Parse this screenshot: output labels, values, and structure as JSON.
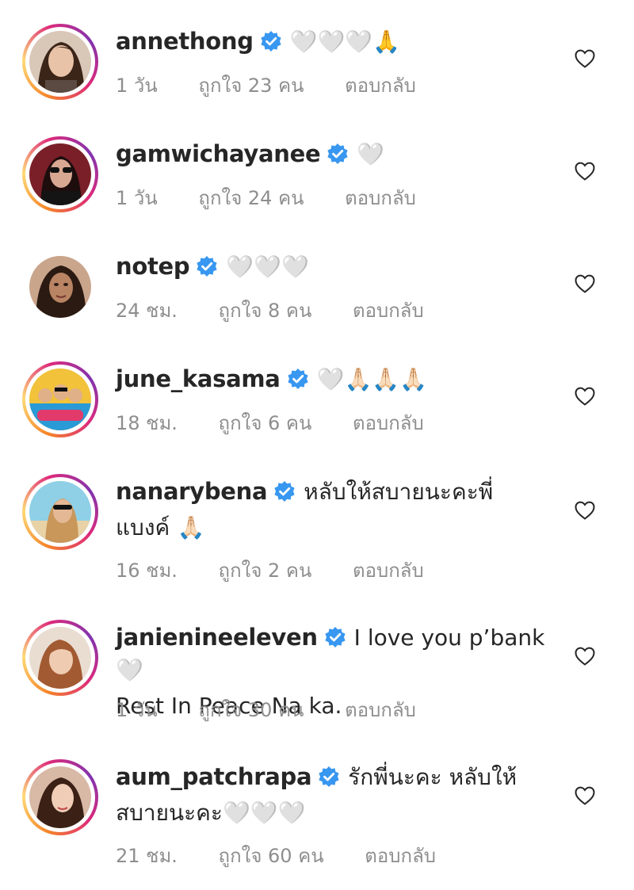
{
  "comments": [
    {
      "username": "annethong",
      "text": "",
      "emoji": "🤍🤍🤍🙏",
      "time": "1 วัน",
      "likes": "ถูกใจ 23 คน",
      "reply": "ตอบกลับ"
    },
    {
      "username": "gamwichayanee",
      "text": "",
      "emoji": "🤍",
      "time": "1 วัน",
      "likes": "ถูกใจ 24 คน",
      "reply": "ตอบกลับ"
    },
    {
      "username": "notep",
      "text": "",
      "emoji": "🤍🤍🤍",
      "time": "24 ชม.",
      "likes": "ถูกใจ 8 คน",
      "reply": "ตอบกลับ"
    },
    {
      "username": "june_kasama",
      "text": "",
      "emoji": "🤍🙏🏻🙏🏻🙏🏻",
      "time": "18 ชม.",
      "likes": "ถูกใจ 6 คน",
      "reply": "ตอบกลับ"
    },
    {
      "username": "nanarybena",
      "text": "หลับให้สบายนะคะพี่",
      "text2": "แบงค์",
      "emoji2": "🙏🏻",
      "time": "16 ชม.",
      "likes": "ถูกใจ 2 คน",
      "reply": "ตอบกลับ"
    },
    {
      "username": "janienineeleven",
      "text": "I love you p’bank",
      "emoji": "🤍",
      "text2": "Rest In Peace Na ka.",
      "time": "1 วัน",
      "likes": "ถูกใจ 30 คน",
      "reply": "ตอบกลับ"
    },
    {
      "username": "aum_patchrapa",
      "text": "รักพี่นะคะ หลับให้",
      "text2": "สบายนะคะ",
      "emoji2": "🤍🤍🤍",
      "time": "21 ชม.",
      "likes": "ถูกใจ 60 คน",
      "reply": "ตอบกลับ"
    }
  ],
  "colors": {
    "verified": "#3897f0",
    "meta": "#8e8e8e",
    "text": "#262626"
  },
  "icons": {
    "verified": "verified-badge-icon",
    "like": "heart-outline-icon"
  }
}
